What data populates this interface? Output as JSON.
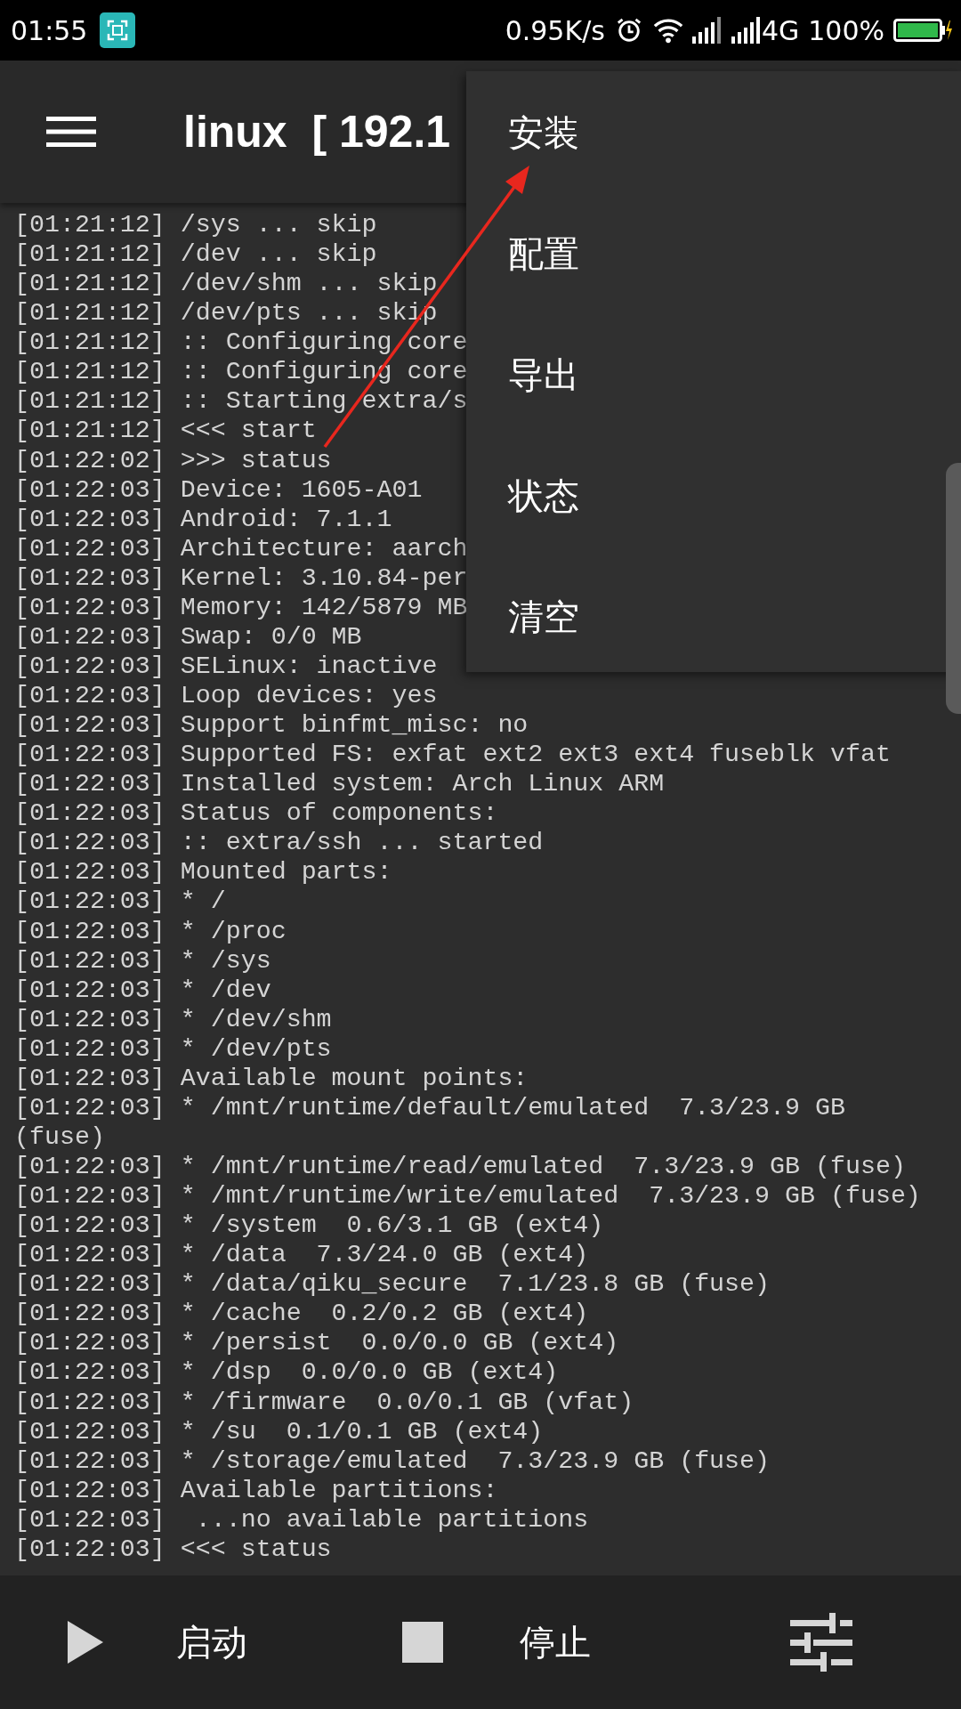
{
  "status_bar": {
    "time": "01:55",
    "network_speed": "0.95K/s",
    "network_type": "4G",
    "battery": "100%"
  },
  "app_bar": {
    "title": "linux  [ 192.1"
  },
  "log": [
    "[01:21:12] /sys ... skip",
    "[01:21:12] /dev ... skip",
    "[01:21:12] /dev/shm ... skip",
    "[01:21:12] /dev/pts ... skip",
    "[01:21:12] :: Configuring core",
    "[01:21:12] :: Configuring core",
    "[01:21:12] :: Starting extra/s",
    "[01:21:12] <<< start",
    "[01:22:02] >>> status",
    "[01:22:03] Device: 1605-A01",
    "[01:22:03] Android: 7.1.1",
    "[01:22:03] Architecture: aarch",
    "[01:22:03] Kernel: 3.10.84-per",
    "[01:22:03] Memory: 142/5879 MB",
    "[01:22:03] Swap: 0/0 MB",
    "[01:22:03] SELinux: inactive",
    "[01:22:03] Loop devices: yes",
    "[01:22:03] Support binfmt_misc: no",
    "[01:22:03] Supported FS: exfat ext2 ext3 ext4 fuseblk vfat",
    "[01:22:03] Installed system: Arch Linux ARM",
    "[01:22:03] Status of components:",
    "[01:22:03] :: extra/ssh ... started",
    "[01:22:03] Mounted parts:",
    "[01:22:03] * /",
    "[01:22:03] * /proc",
    "[01:22:03] * /sys",
    "[01:22:03] * /dev",
    "[01:22:03] * /dev/shm",
    "[01:22:03] * /dev/pts",
    "[01:22:03] Available mount points:",
    "[01:22:03] * /mnt/runtime/default/emulated  7.3/23.9 GB (fuse)",
    "[01:22:03] * /mnt/runtime/read/emulated  7.3/23.9 GB (fuse)",
    "[01:22:03] * /mnt/runtime/write/emulated  7.3/23.9 GB (fuse)",
    "[01:22:03] * /system  0.6/3.1 GB (ext4)",
    "[01:22:03] * /data  7.3/24.0 GB (ext4)",
    "[01:22:03] * /data/qiku_secure  7.1/23.8 GB (fuse)",
    "[01:22:03] * /cache  0.2/0.2 GB (ext4)",
    "[01:22:03] * /persist  0.0/0.0 GB (ext4)",
    "[01:22:03] * /dsp  0.0/0.0 GB (ext4)",
    "[01:22:03] * /firmware  0.0/0.1 GB (vfat)",
    "[01:22:03] * /su  0.1/0.1 GB (ext4)",
    "[01:22:03] * /storage/emulated  7.3/23.9 GB (fuse)",
    "[01:22:03] Available partitions:",
    "[01:22:03]  ...no available partitions",
    "[01:22:03] <<< status"
  ],
  "menu": [
    {
      "label": "安装"
    },
    {
      "label": "配置"
    },
    {
      "label": "导出"
    },
    {
      "label": "状态"
    },
    {
      "label": "清空"
    }
  ],
  "bottom_bar": {
    "start": "启动",
    "stop": "停止"
  }
}
